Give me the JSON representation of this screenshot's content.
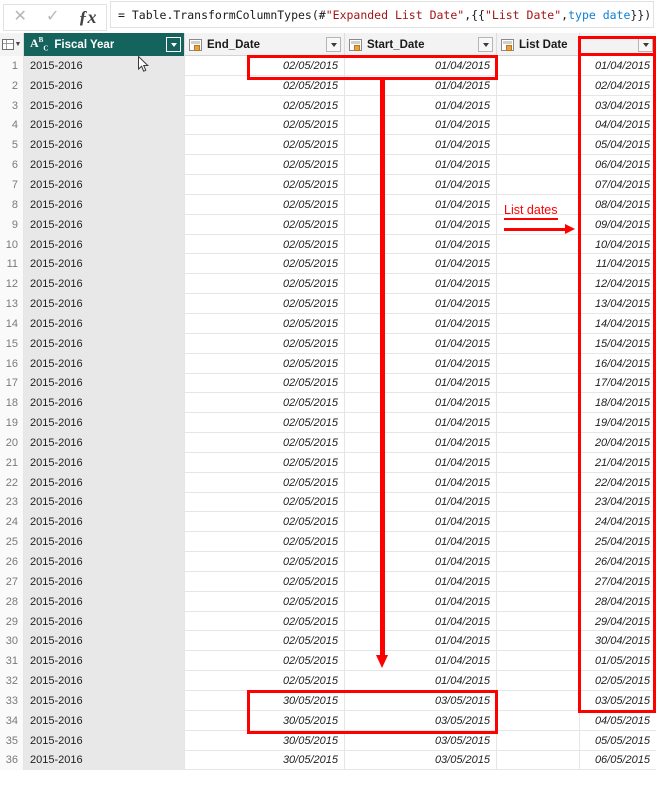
{
  "formula_bar": {
    "cancel_icon": "close-icon",
    "accept_icon": "check-icon",
    "fx_icon": "fx-icon",
    "formula_prefix": "= Table.TransformColumnTypes(#",
    "formula_str1": "\"Expanded List Date\"",
    "formula_mid": ",{{",
    "formula_str2": "\"List Date\"",
    "formula_comma": ", ",
    "formula_kw": "type date",
    "formula_suffix": "}})"
  },
  "columns": [
    {
      "label": "Fiscal Year",
      "type_icon": "abc-text-type-icon",
      "selected": true
    },
    {
      "label": "End_Date",
      "type_icon": "calendar-date-type-icon",
      "selected": false
    },
    {
      "label": "Start_Date",
      "type_icon": "calendar-date-type-icon",
      "selected": false
    },
    {
      "label": "List Date",
      "type_icon": "calendar-date-type-icon",
      "selected": false
    },
    {
      "label": "",
      "type_icon": "",
      "selected": false
    }
  ],
  "annotations": {
    "list_dates_label": "List dates",
    "accent_color": "#ff0000",
    "selected_header_color": "#14635c"
  },
  "rows": [
    {
      "n": "1",
      "fiscal_year": "2015-2016",
      "end_date": "02/05/2015",
      "start_date": "01/04/2015",
      "list_date": "",
      "last": "01/04/2015"
    },
    {
      "n": "2",
      "fiscal_year": "2015-2016",
      "end_date": "02/05/2015",
      "start_date": "01/04/2015",
      "list_date": "",
      "last": "02/04/2015"
    },
    {
      "n": "3",
      "fiscal_year": "2015-2016",
      "end_date": "02/05/2015",
      "start_date": "01/04/2015",
      "list_date": "",
      "last": "03/04/2015"
    },
    {
      "n": "4",
      "fiscal_year": "2015-2016",
      "end_date": "02/05/2015",
      "start_date": "01/04/2015",
      "list_date": "",
      "last": "04/04/2015"
    },
    {
      "n": "5",
      "fiscal_year": "2015-2016",
      "end_date": "02/05/2015",
      "start_date": "01/04/2015",
      "list_date": "",
      "last": "05/04/2015"
    },
    {
      "n": "6",
      "fiscal_year": "2015-2016",
      "end_date": "02/05/2015",
      "start_date": "01/04/2015",
      "list_date": "",
      "last": "06/04/2015"
    },
    {
      "n": "7",
      "fiscal_year": "2015-2016",
      "end_date": "02/05/2015",
      "start_date": "01/04/2015",
      "list_date": "",
      "last": "07/04/2015"
    },
    {
      "n": "8",
      "fiscal_year": "2015-2016",
      "end_date": "02/05/2015",
      "start_date": "01/04/2015",
      "list_date": "",
      "last": "08/04/2015"
    },
    {
      "n": "9",
      "fiscal_year": "2015-2016",
      "end_date": "02/05/2015",
      "start_date": "01/04/2015",
      "list_date": "",
      "last": "09/04/2015"
    },
    {
      "n": "10",
      "fiscal_year": "2015-2016",
      "end_date": "02/05/2015",
      "start_date": "01/04/2015",
      "list_date": "",
      "last": "10/04/2015"
    },
    {
      "n": "11",
      "fiscal_year": "2015-2016",
      "end_date": "02/05/2015",
      "start_date": "01/04/2015",
      "list_date": "",
      "last": "11/04/2015"
    },
    {
      "n": "12",
      "fiscal_year": "2015-2016",
      "end_date": "02/05/2015",
      "start_date": "01/04/2015",
      "list_date": "",
      "last": "12/04/2015"
    },
    {
      "n": "13",
      "fiscal_year": "2015-2016",
      "end_date": "02/05/2015",
      "start_date": "01/04/2015",
      "list_date": "",
      "last": "13/04/2015"
    },
    {
      "n": "14",
      "fiscal_year": "2015-2016",
      "end_date": "02/05/2015",
      "start_date": "01/04/2015",
      "list_date": "",
      "last": "14/04/2015"
    },
    {
      "n": "15",
      "fiscal_year": "2015-2016",
      "end_date": "02/05/2015",
      "start_date": "01/04/2015",
      "list_date": "",
      "last": "15/04/2015"
    },
    {
      "n": "16",
      "fiscal_year": "2015-2016",
      "end_date": "02/05/2015",
      "start_date": "01/04/2015",
      "list_date": "",
      "last": "16/04/2015"
    },
    {
      "n": "17",
      "fiscal_year": "2015-2016",
      "end_date": "02/05/2015",
      "start_date": "01/04/2015",
      "list_date": "",
      "last": "17/04/2015"
    },
    {
      "n": "18",
      "fiscal_year": "2015-2016",
      "end_date": "02/05/2015",
      "start_date": "01/04/2015",
      "list_date": "",
      "last": "18/04/2015"
    },
    {
      "n": "19",
      "fiscal_year": "2015-2016",
      "end_date": "02/05/2015",
      "start_date": "01/04/2015",
      "list_date": "",
      "last": "19/04/2015"
    },
    {
      "n": "20",
      "fiscal_year": "2015-2016",
      "end_date": "02/05/2015",
      "start_date": "01/04/2015",
      "list_date": "",
      "last": "20/04/2015"
    },
    {
      "n": "21",
      "fiscal_year": "2015-2016",
      "end_date": "02/05/2015",
      "start_date": "01/04/2015",
      "list_date": "",
      "last": "21/04/2015"
    },
    {
      "n": "22",
      "fiscal_year": "2015-2016",
      "end_date": "02/05/2015",
      "start_date": "01/04/2015",
      "list_date": "",
      "last": "22/04/2015"
    },
    {
      "n": "23",
      "fiscal_year": "2015-2016",
      "end_date": "02/05/2015",
      "start_date": "01/04/2015",
      "list_date": "",
      "last": "23/04/2015"
    },
    {
      "n": "24",
      "fiscal_year": "2015-2016",
      "end_date": "02/05/2015",
      "start_date": "01/04/2015",
      "list_date": "",
      "last": "24/04/2015"
    },
    {
      "n": "25",
      "fiscal_year": "2015-2016",
      "end_date": "02/05/2015",
      "start_date": "01/04/2015",
      "list_date": "",
      "last": "25/04/2015"
    },
    {
      "n": "26",
      "fiscal_year": "2015-2016",
      "end_date": "02/05/2015",
      "start_date": "01/04/2015",
      "list_date": "",
      "last": "26/04/2015"
    },
    {
      "n": "27",
      "fiscal_year": "2015-2016",
      "end_date": "02/05/2015",
      "start_date": "01/04/2015",
      "list_date": "",
      "last": "27/04/2015"
    },
    {
      "n": "28",
      "fiscal_year": "2015-2016",
      "end_date": "02/05/2015",
      "start_date": "01/04/2015",
      "list_date": "",
      "last": "28/04/2015"
    },
    {
      "n": "29",
      "fiscal_year": "2015-2016",
      "end_date": "02/05/2015",
      "start_date": "01/04/2015",
      "list_date": "",
      "last": "29/04/2015"
    },
    {
      "n": "30",
      "fiscal_year": "2015-2016",
      "end_date": "02/05/2015",
      "start_date": "01/04/2015",
      "list_date": "",
      "last": "30/04/2015"
    },
    {
      "n": "31",
      "fiscal_year": "2015-2016",
      "end_date": "02/05/2015",
      "start_date": "01/04/2015",
      "list_date": "",
      "last": "01/05/2015"
    },
    {
      "n": "32",
      "fiscal_year": "2015-2016",
      "end_date": "02/05/2015",
      "start_date": "01/04/2015",
      "list_date": "",
      "last": "02/05/2015"
    },
    {
      "n": "33",
      "fiscal_year": "2015-2016",
      "end_date": "30/05/2015",
      "start_date": "03/05/2015",
      "list_date": "",
      "last": "03/05/2015"
    },
    {
      "n": "34",
      "fiscal_year": "2015-2016",
      "end_date": "30/05/2015",
      "start_date": "03/05/2015",
      "list_date": "",
      "last": "04/05/2015"
    },
    {
      "n": "35",
      "fiscal_year": "2015-2016",
      "end_date": "30/05/2015",
      "start_date": "03/05/2015",
      "list_date": "",
      "last": "05/05/2015"
    },
    {
      "n": "36",
      "fiscal_year": "2015-2016",
      "end_date": "30/05/2015",
      "start_date": "03/05/2015",
      "list_date": "",
      "last": "06/05/2015"
    }
  ]
}
